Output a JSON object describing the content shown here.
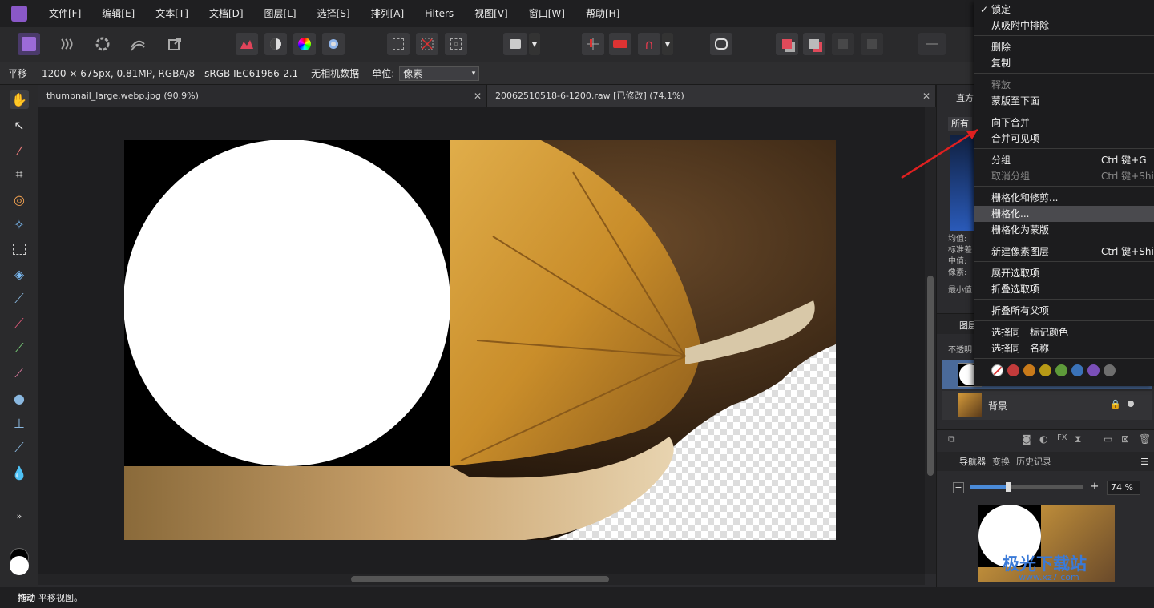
{
  "menubar": {
    "items": [
      "文件[F]",
      "编辑[E]",
      "文本[T]",
      "文档[D]",
      "图层[L]",
      "选择[S]",
      "排列[A]",
      "Filters",
      "视图[V]",
      "窗口[W]",
      "帮助[H]"
    ]
  },
  "context_toolbar": {
    "tool_name": "平移",
    "doc_info": "1200 × 675px, 0.81MP, RGBA/8 - sRGB IEC61966-2.1",
    "camera": "无相机数据",
    "unit_label": "单位:",
    "unit_value": "像素"
  },
  "tabs": [
    {
      "label": "thumbnail_large.webp.jpg (90.9%)"
    },
    {
      "label": "20062510518-6-1200.raw [已修改] (74.1%)"
    }
  ],
  "status": {
    "action": "拖动",
    "hint": "平移视图。"
  },
  "right_panel": {
    "histogram_tab": "直方",
    "histogram_filter": "所有",
    "stats": [
      "均值:",
      "标准差",
      "中值:",
      "像素:",
      "最小值"
    ],
    "layers_tab": "图层",
    "opacity_label": "不透明",
    "layer_bg_name": "背景",
    "nav_tabs": [
      "导航器",
      "变换",
      "历史记录"
    ],
    "zoom_value": "74 %"
  },
  "context_menu": {
    "lock": "锁定",
    "remove_snap": "从吸附中排除",
    "delete": "删除",
    "duplicate": "复制",
    "release": "释放",
    "mask_below": "蒙版至下面",
    "merge_down": "向下合并",
    "merge_visible": "合并可见项",
    "group": "分组",
    "group_shortcut": "Ctrl 键+G",
    "ungroup": "取消分组",
    "ungroup_shortcut": "Ctrl 键+Shif",
    "rasterize_trim": "栅格化和修剪...",
    "rasterize": "栅格化...",
    "rasterize_mask": "栅格化为蒙版",
    "new_pixel_layer": "新建像素图层",
    "new_pixel_shortcut": "Ctrl 键+Shif",
    "expand_selection": "展开选取项",
    "collapse_selection": "折叠选取项",
    "collapse_parents": "折叠所有父项",
    "select_same_color": "选择同一标记颜色",
    "select_same_name": "选择同一名称"
  },
  "tag_colors": [
    "#c23b3b",
    "#c87a1a",
    "#b89a16",
    "#5e9a3a",
    "#3a72b8",
    "#7a4fb8",
    "#6e6e6e"
  ],
  "watermark": {
    "text": "极光下载站",
    "url": "www.xz7.com"
  }
}
